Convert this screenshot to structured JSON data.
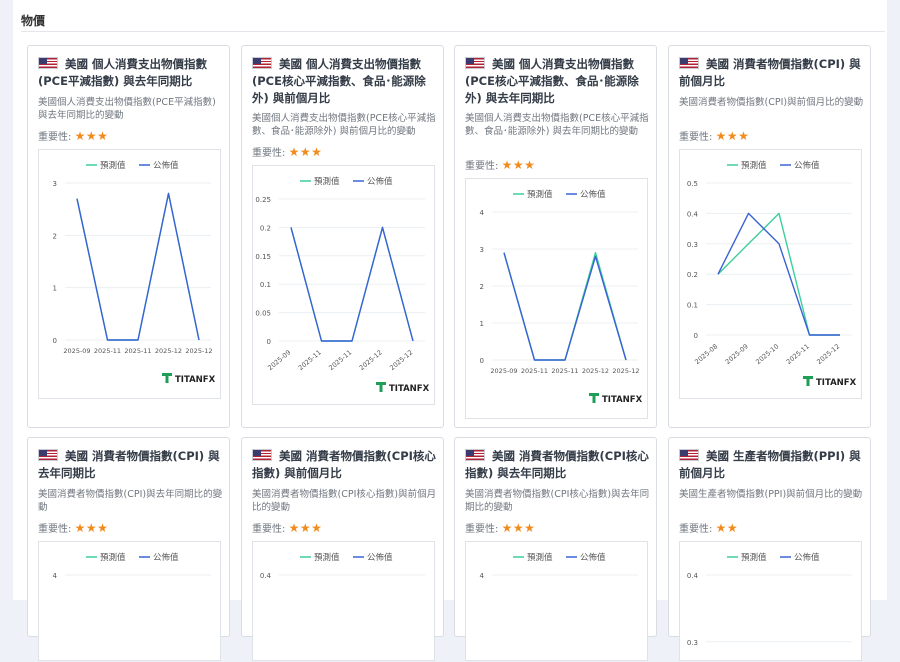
{
  "section": {
    "title": "物價"
  },
  "common": {
    "importance_label": "重要性:",
    "legend_forecast": "預測值",
    "legend_actual": "公佈值",
    "logo": "TITANFX",
    "colors": {
      "forecast": "#3ccf9a",
      "actual": "#3a62d6",
      "star": "#f08c1e"
    }
  },
  "cards": [
    {
      "flag_icon": "us-flag-icon",
      "title": "美國 個人消費支出物價指數(PCE平減指數) 與去年同期比",
      "desc": "美國個人消費支出物價指數(PCE平減指數) 與去年同期比的變動",
      "stars": "★★★"
    },
    {
      "flag_icon": "us-flag-icon",
      "title": "美國 個人消費支出物價指數(PCE核心平減指數、食品･能源除外) 與前個月比",
      "desc": "美國個人消費支出物價指數(PCE核心平減指數、食品･能源除外) 與前個月比的變動",
      "stars": "★★★"
    },
    {
      "flag_icon": "us-flag-icon",
      "title": "美國 個人消費支出物價指數(PCE核心平減指數、食品･能源除外) 與去年同期比",
      "desc": "美國個人消費支出物價指數(PCE核心平減指數、食品･能源除外) 與去年同期比的變動",
      "stars": "★★★"
    },
    {
      "flag_icon": "us-flag-icon",
      "title": "美國 消費者物價指數(CPI) 與前個月比",
      "desc": "美國消費者物價指數(CPI)與前個月比的變動",
      "stars": "★★★"
    },
    {
      "flag_icon": "us-flag-icon",
      "title": "美國 消費者物價指數(CPI) 與去年同期比",
      "desc": "美國消費者物價指數(CPI)與去年同期比的變動",
      "stars": "★★★"
    },
    {
      "flag_icon": "us-flag-icon",
      "title": "美國 消費者物價指數(CPI核心指數) 與前個月比",
      "desc": "美國消費者物價指數(CPI核心指數)與前個月比的變動",
      "stars": "★★★"
    },
    {
      "flag_icon": "us-flag-icon",
      "title": "美國 消費者物價指數(CPI核心指數) 與去年同期比",
      "desc": "美國消費者物價指數(CPI核心指數)與去年同期比的變動",
      "stars": "★★★"
    },
    {
      "flag_icon": "us-flag-icon",
      "title": "美國 生產者物價指數(PPI) 與前個月比",
      "desc": "美國生產者物價指數(PPI)與前個月比的變動",
      "stars": "★★"
    }
  ],
  "chart_data": [
    {
      "type": "line",
      "x": [
        "2025-09",
        "2025-11",
        "2025-11",
        "2025-12",
        "2025-12"
      ],
      "ylim": [
        0,
        3
      ],
      "yticks": [
        0,
        1,
        2,
        3
      ],
      "tick_rotation": 0,
      "series": [
        {
          "name": "預測值",
          "values": [
            2.7,
            0,
            0,
            2.8,
            0
          ]
        },
        {
          "name": "公佈值",
          "values": [
            2.7,
            0,
            0,
            2.8,
            0
          ]
        }
      ],
      "legend": "top"
    },
    {
      "type": "line",
      "x": [
        "2025-09",
        "2025-11",
        "2025-11",
        "2025-12",
        "2025-12"
      ],
      "ylim": [
        0,
        0.25
      ],
      "yticks": [
        0,
        0.05,
        0.1,
        0.15,
        0.2,
        0.25
      ],
      "tick_rotation": -40,
      "series": [
        {
          "name": "預測值",
          "values": [
            0.2,
            0,
            0,
            0.2,
            0
          ]
        },
        {
          "name": "公佈值",
          "values": [
            0.2,
            0,
            0,
            0.2,
            0
          ]
        }
      ],
      "legend": "top"
    },
    {
      "type": "line",
      "x": [
        "2025-09",
        "2025-11",
        "2025-11",
        "2025-12",
        "2025-12"
      ],
      "ylim": [
        0,
        4
      ],
      "yticks": [
        0,
        1,
        2,
        3,
        4
      ],
      "tick_rotation": 0,
      "series": [
        {
          "name": "預測值",
          "values": [
            2.9,
            0,
            0,
            2.9,
            0
          ]
        },
        {
          "name": "公佈值",
          "values": [
            2.9,
            0,
            0,
            2.8,
            0
          ]
        }
      ],
      "legend": "top"
    },
    {
      "type": "line",
      "x": [
        "2025-08",
        "2025-09",
        "2025-10",
        "2025-11",
        "2025-12"
      ],
      "ylim": [
        0,
        0.5
      ],
      "yticks": [
        0,
        0.1,
        0.2,
        0.3,
        0.4,
        0.5
      ],
      "tick_rotation": -40,
      "series": [
        {
          "name": "預測值",
          "values": [
            0.2,
            0.3,
            0.4,
            0,
            0
          ]
        },
        {
          "name": "公佈值",
          "values": [
            0.2,
            0.4,
            0.3,
            0,
            0
          ]
        }
      ],
      "legend": "top"
    },
    {
      "type": "line",
      "x": [],
      "ylim": [
        0,
        4
      ],
      "yticks": [
        4
      ],
      "tick_rotation": 0,
      "series": [
        {
          "name": "預測值",
          "values": []
        },
        {
          "name": "公佈值",
          "values": []
        }
      ],
      "legend": "top"
    },
    {
      "type": "line",
      "x": [],
      "ylim": [
        0,
        0.4
      ],
      "yticks": [
        0.4
      ],
      "tick_rotation": 0,
      "series": [
        {
          "name": "預測值",
          "values": []
        },
        {
          "name": "公佈值",
          "values": []
        }
      ],
      "legend": "top"
    },
    {
      "type": "line",
      "x": [],
      "ylim": [
        0,
        4
      ],
      "yticks": [
        4
      ],
      "tick_rotation": 0,
      "series": [
        {
          "name": "預測值",
          "values": []
        },
        {
          "name": "公佈值",
          "values": []
        }
      ],
      "legend": "top"
    },
    {
      "type": "line",
      "x": [],
      "ylim": [
        0,
        0.4
      ],
      "yticks": [
        0.3,
        0.4
      ],
      "tick_rotation": 0,
      "series": [
        {
          "name": "預測值",
          "values": []
        },
        {
          "name": "公佈值",
          "values": []
        }
      ],
      "legend": "top"
    }
  ]
}
